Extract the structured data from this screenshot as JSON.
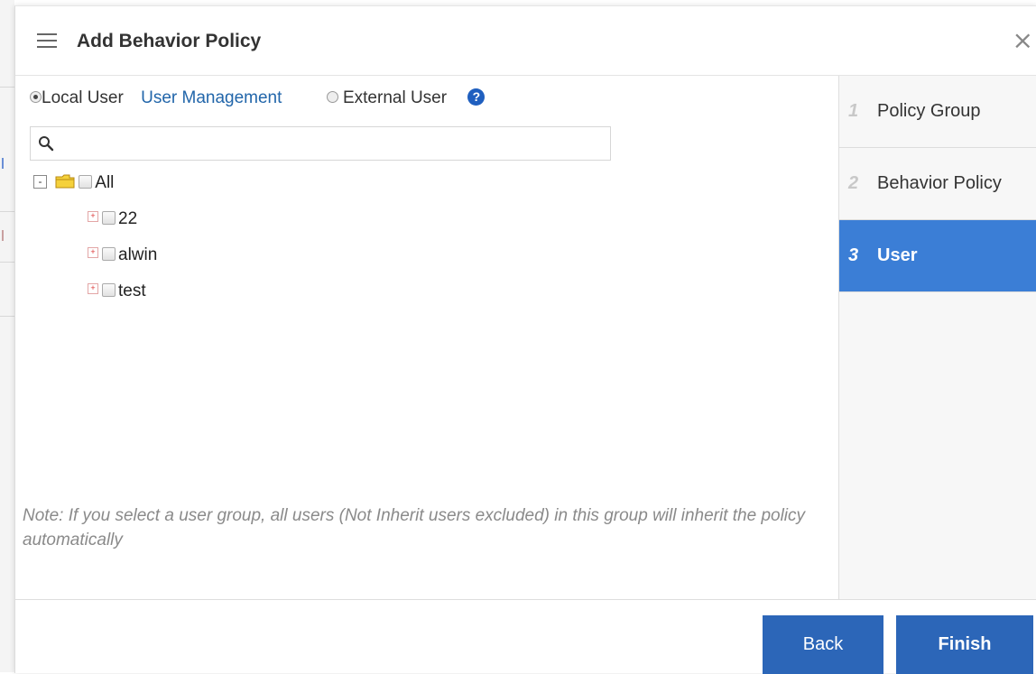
{
  "dialog": {
    "title": "Add Behavior Policy",
    "close_symbol": "×"
  },
  "user_type": {
    "local_label": "Local User",
    "local_selected": true,
    "management_link": "User Management",
    "external_label": "External User",
    "external_selected": false,
    "help_symbol": "?"
  },
  "search": {
    "value": "",
    "placeholder": ""
  },
  "tree": {
    "root": {
      "label": "All",
      "expanded": true,
      "checked": false
    },
    "children": [
      {
        "label": "22",
        "checked": false
      },
      {
        "label": "alwin",
        "checked": false
      },
      {
        "label": "test",
        "checked": false
      }
    ]
  },
  "note": "Note: If you select a user group, all users (Not Inherit users excluded) in this group will inherit the policy automatically",
  "steps": [
    {
      "num": "1",
      "label": "Policy Group",
      "active": false
    },
    {
      "num": "2",
      "label": "Behavior Policy",
      "active": false
    },
    {
      "num": "3",
      "label": "User",
      "active": true
    }
  ],
  "buttons": {
    "back": "Back",
    "finish": "Finish"
  },
  "colors": {
    "accent": "#3b7ed6",
    "button": "#2c66b8",
    "link": "#2266aa"
  },
  "icons": [
    "menu-icon",
    "close-icon",
    "help-icon",
    "search-icon",
    "folder-icon",
    "expand-icon",
    "collapse-icon"
  ]
}
